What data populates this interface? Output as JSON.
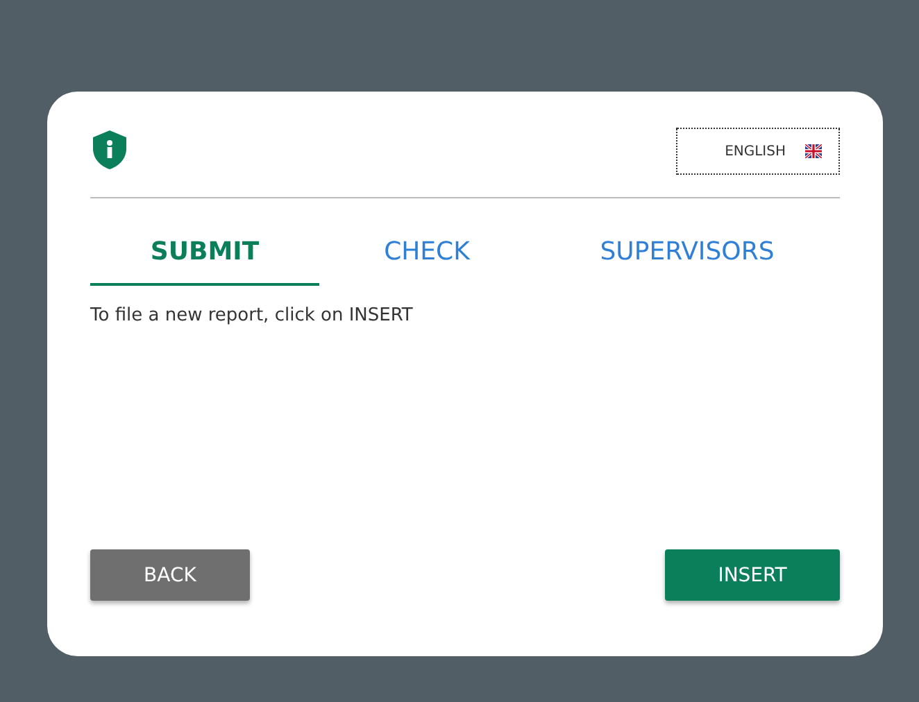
{
  "language": {
    "label": "ENGLISH"
  },
  "tabs": [
    {
      "label": "SUBMIT",
      "selected": true
    },
    {
      "label": "CHECK",
      "selected": false
    },
    {
      "label": "SUPERVISORS",
      "selected": false
    }
  ],
  "message": "To file a new report, click on INSERT",
  "buttons": [
    {
      "label": "BACK",
      "kind": "secondary"
    },
    {
      "label": "INSERT",
      "kind": "primary"
    }
  ]
}
